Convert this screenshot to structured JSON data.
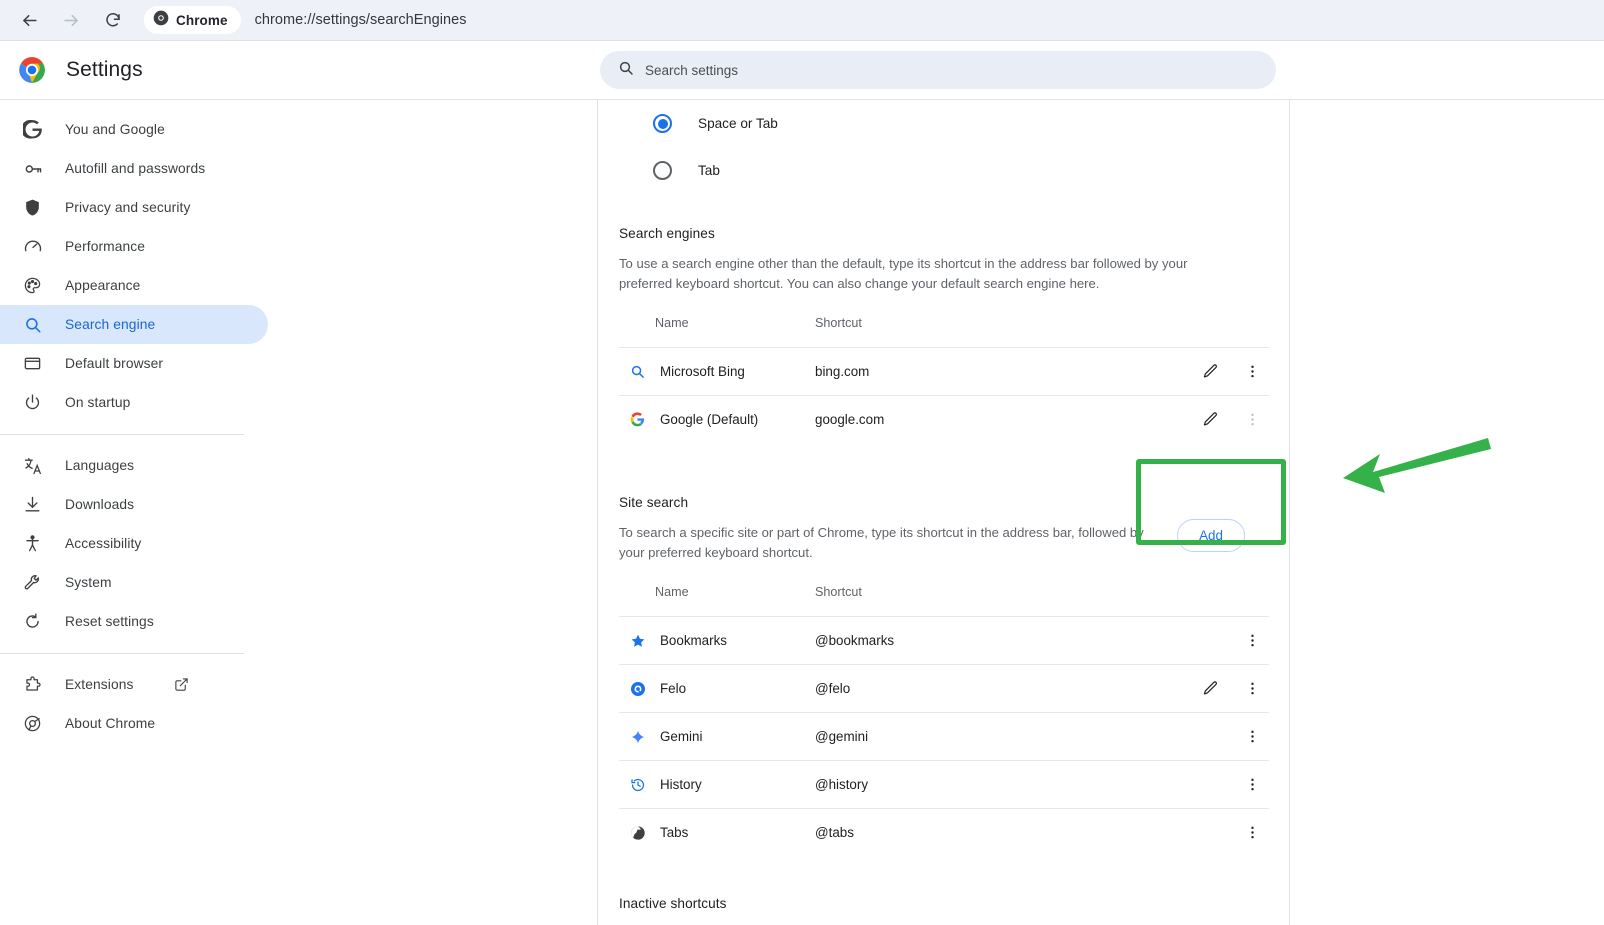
{
  "browser": {
    "back_icon": "back-arrow-icon",
    "forward_icon": "forward-arrow-icon",
    "reload_icon": "reload-icon",
    "chip_label": "Chrome",
    "chip_icon": "chrome-logo-icon",
    "url": "chrome://settings/searchEngines"
  },
  "header": {
    "logo_icon": "chrome-logo-icon",
    "title": "Settings",
    "search": {
      "icon": "search-icon",
      "placeholder": "Search settings",
      "value": ""
    }
  },
  "sidebar": {
    "items": [
      {
        "label": "You and Google",
        "icon": "google-g-icon",
        "selected": false
      },
      {
        "label": "Autofill and passwords",
        "icon": "key-icon",
        "selected": false
      },
      {
        "label": "Privacy and security",
        "icon": "shield-icon",
        "selected": false
      },
      {
        "label": "Performance",
        "icon": "speedometer-icon",
        "selected": false
      },
      {
        "label": "Appearance",
        "icon": "palette-icon",
        "selected": false
      },
      {
        "label": "Search engine",
        "icon": "search-icon",
        "selected": true
      },
      {
        "label": "Default browser",
        "icon": "window-icon",
        "selected": false
      },
      {
        "label": "On startup",
        "icon": "power-icon",
        "selected": false
      }
    ],
    "items_group2": [
      {
        "label": "Languages",
        "icon": "translate-icon",
        "selected": false
      },
      {
        "label": "Downloads",
        "icon": "download-icon",
        "selected": false
      },
      {
        "label": "Accessibility",
        "icon": "accessibility-icon",
        "selected": false
      },
      {
        "label": "System",
        "icon": "wrench-icon",
        "selected": false
      },
      {
        "label": "Reset settings",
        "icon": "restore-icon",
        "selected": false
      }
    ],
    "items_group3": [
      {
        "label": "Extensions",
        "icon": "extension-icon",
        "external": true,
        "external_icon": "open-in-new-icon",
        "selected": false
      },
      {
        "label": "About Chrome",
        "icon": "chrome-logo-icon",
        "external": false,
        "selected": false
      }
    ]
  },
  "main": {
    "radio_options": [
      {
        "label": "Space or Tab",
        "checked": true
      },
      {
        "label": "Tab",
        "checked": false
      }
    ],
    "search_engines": {
      "title": "Search engines",
      "description": "To use a search engine other than the default, type its shortcut in the address bar followed by your preferred keyboard shortcut. You can also change your default search engine here.",
      "columns": {
        "name": "Name",
        "shortcut": "Shortcut"
      },
      "rows": [
        {
          "name": "Microsoft Bing",
          "shortcut": "bing.com",
          "icon": "bing-search-icon",
          "edit": "edit-pencil-icon",
          "menu": "more-vertical-icon",
          "menu_muted": false,
          "has_edit": true
        },
        {
          "name": "Google (Default)",
          "shortcut": "google.com",
          "icon": "google-g-icon",
          "edit": "edit-pencil-icon",
          "menu": "more-vertical-icon",
          "menu_muted": true,
          "has_edit": true
        }
      ]
    },
    "site_search": {
      "title": "Site search",
      "description": "To search a specific site or part of Chrome, type its shortcut in the address bar, followed by your preferred keyboard shortcut.",
      "add_label": "Add",
      "columns": {
        "name": "Name",
        "shortcut": "Shortcut"
      },
      "rows": [
        {
          "name": "Bookmarks",
          "shortcut": "@bookmarks",
          "icon": "star-icon",
          "has_edit": false,
          "menu": "more-vertical-icon"
        },
        {
          "name": "Felo",
          "shortcut": "@felo",
          "icon": "felo-icon",
          "has_edit": true,
          "edit": "edit-pencil-icon",
          "menu": "more-vertical-icon"
        },
        {
          "name": "Gemini",
          "shortcut": "@gemini",
          "icon": "gemini-sparkle-icon",
          "has_edit": false,
          "menu": "more-vertical-icon"
        },
        {
          "name": "History",
          "shortcut": "@history",
          "icon": "history-clock-icon",
          "has_edit": false,
          "menu": "more-vertical-icon"
        },
        {
          "name": "Tabs",
          "shortcut": "@tabs",
          "icon": "globe-icon",
          "has_edit": false,
          "menu": "more-vertical-icon"
        }
      ]
    },
    "inactive_shortcuts": {
      "title": "Inactive shortcuts"
    }
  },
  "annotation": {
    "color": "#35b14a",
    "box_target": "Add",
    "arrow_icon": "annotation-arrow-icon"
  }
}
